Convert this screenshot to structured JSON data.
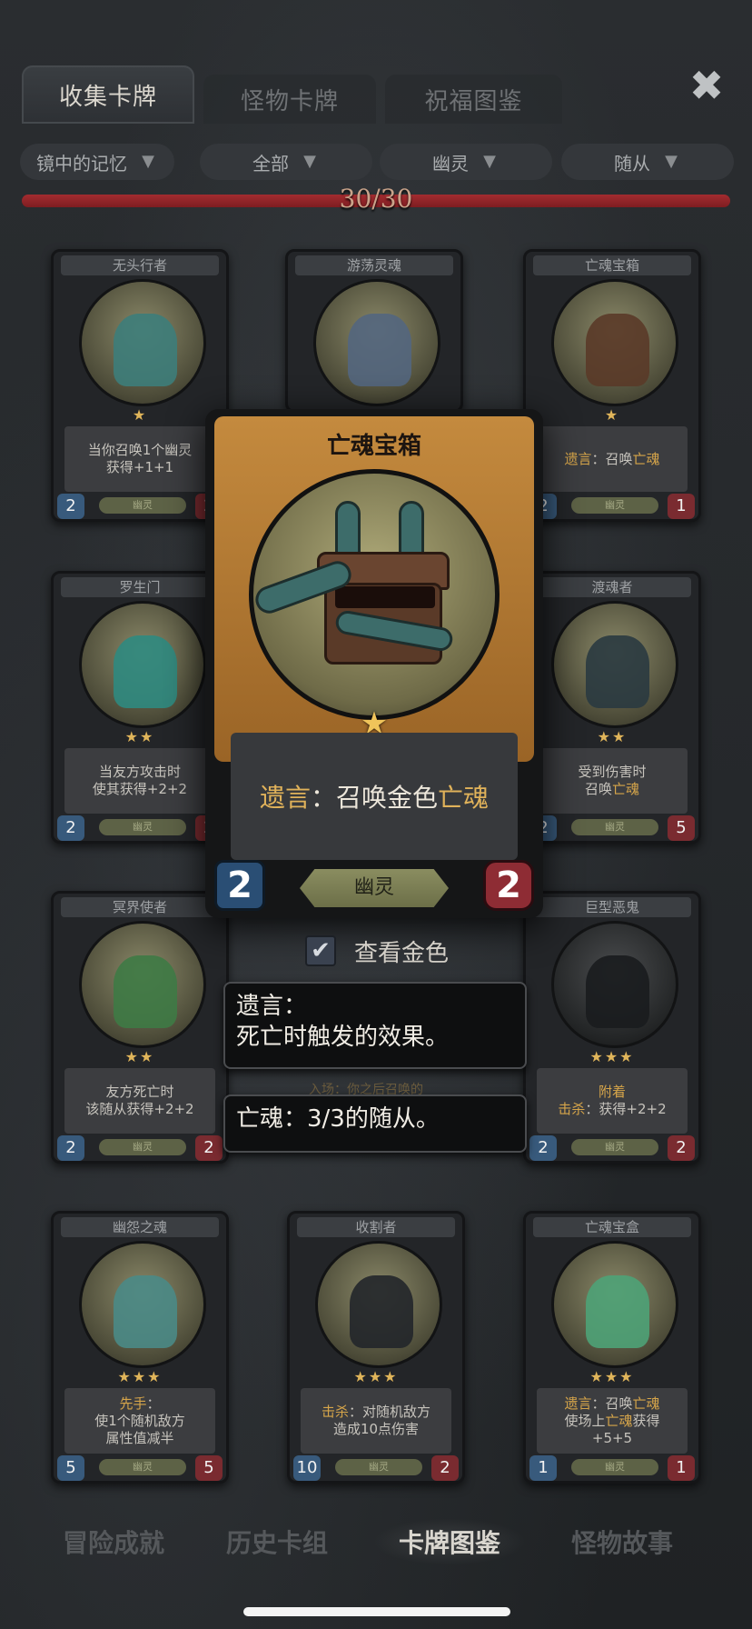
{
  "tabs": {
    "collect": "收集卡牌",
    "monster": "怪物卡牌",
    "blessing": "祝福图鉴"
  },
  "filters": {
    "memory": "镜中的记忆",
    "all": "全部",
    "ghost": "幽灵",
    "minion": "随从"
  },
  "progress": {
    "text": "30/30",
    "fraction": 1.0
  },
  "cards": [
    {
      "name": "无头行者",
      "stars": "★",
      "desc": "当你召唤1个幽灵\n获得+1+1",
      "type": "幽灵",
      "atk": "2",
      "hp": "2"
    },
    {
      "name": "游荡灵魂",
      "stars": "",
      "desc": "",
      "type": "",
      "atk": "",
      "hp": ""
    },
    {
      "name": "亡魂宝箱",
      "stars": "★",
      "desc_kw": "遗言",
      "desc_mid": "：召唤",
      "desc_hl": "亡魂",
      "type": "幽灵",
      "atk": "2",
      "hp": "1"
    },
    {
      "name": "罗生门",
      "stars": "★★",
      "desc": "当友方攻击时\n使其获得+2+2",
      "type": "幽灵",
      "atk": "2",
      "hp": "2"
    },
    {
      "name": "渡魂者",
      "stars": "★★",
      "desc_pre": "受到伤害时\n召唤",
      "desc_hl": "亡魂",
      "type": "幽灵",
      "atk": "2",
      "hp": "5"
    },
    {
      "name": "冥界使者",
      "stars": "★★",
      "desc": "友方死亡时\n该随从获得+2+2",
      "type": "幽灵",
      "atk": "2",
      "hp": "2"
    },
    {
      "name": "巨型恶鬼",
      "stars": "★★★",
      "desc_kw": "附着",
      "desc_kw2": "击杀",
      "desc_rest": "：获得+2+2",
      "type": "幽灵",
      "atk": "2",
      "hp": "2"
    },
    {
      "name": "幽怨之魂",
      "stars": "★★★",
      "desc_kw": "先手",
      "desc_rest": "：\n使1个随机敌方\n属性值减半",
      "type": "幽灵",
      "atk": "5",
      "hp": "5"
    },
    {
      "name": "收割者",
      "stars": "★★★",
      "desc_kw": "击杀",
      "desc_rest": "：对随机敌方\n造成10点伤害",
      "type": "幽灵",
      "atk": "10",
      "hp": "2"
    },
    {
      "name": "亡魂宝盒",
      "stars": "★★★",
      "desc_kw": "遗言",
      "desc_mid": "：召唤",
      "desc_hl": "亡魂",
      "desc_rest": "使场上",
      "desc_hl2": "亡魂",
      "desc_end": "获得\n+5+5",
      "type": "幽灵",
      "atk": "1",
      "hp": "1"
    }
  ],
  "popup": {
    "title": "亡魂宝箱",
    "star": "★",
    "desc_kw": "遗言",
    "desc_mid": "：召唤金色",
    "desc_hl": "亡魂",
    "type": "幽灵",
    "atk": "2",
    "hp": "2"
  },
  "gold_toggle": {
    "checked": true,
    "label": "查看金色"
  },
  "tooltips": {
    "deathrattle_line1": "遗言：",
    "deathrattle_line2": "死亡时触发的效果。",
    "soul": "亡魂：3/3的随从。"
  },
  "peek_text": "入场：你之后召唤的",
  "bottom_nav": {
    "achievements": "冒险成就",
    "history": "历史卡组",
    "codex": "卡牌图鉴",
    "stories": "怪物故事"
  },
  "colors": {
    "accent_gold": "#e0b25a",
    "progress_red": "#a32c30",
    "atk_blue": "#2a4e74",
    "hp_red": "#8e2c34"
  },
  "icons": {
    "close": "close-icon",
    "filter_chevron": "chevron-down-icon",
    "check": "checkmark-icon"
  }
}
